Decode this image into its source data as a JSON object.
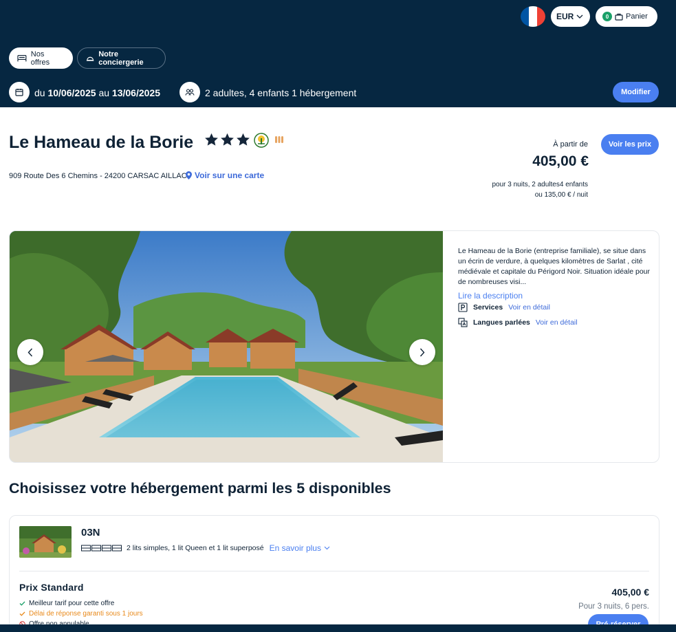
{
  "header": {
    "currency": "EUR",
    "cart_count": "0",
    "cart_label": "Panier",
    "tabs": [
      {
        "label": "Nos offres",
        "icon": "bed-icon"
      },
      {
        "label": "Notre conciergerie",
        "icon": "cloche-icon"
      }
    ],
    "dates": {
      "prefix": "du",
      "start": "10/06/2025",
      "middle": "au",
      "end": "13/06/2025"
    },
    "guests": "2 adultes, 4 enfants 1 hébergement",
    "modify_label": "Modifier",
    "flag_colors": [
      "#0055a4",
      "#ffffff",
      "#ef4135"
    ]
  },
  "hotel": {
    "name": "Le Hameau de la Borie",
    "stars": 3,
    "address": "909 Route Des 6 Chemins - 24200 CARSAC AILLAC",
    "map_link": "Voir sur une carte",
    "from_label": "À partir de",
    "price": "405,00 €",
    "price_line1": "pour 3 nuits, 2 adultes4 enfants",
    "price_line2": "ou 135,00 € / nuit",
    "see_prices_label": "Voir les prix",
    "description": "Le Hameau de la Borie (entreprise familiale), se situe dans un écrin de verdure, à quelques kilomètres de Sarlat , cité médiévale et capitale du Périgord Noir. Situation idéale pour de nombreuses visi...",
    "read_more": "Lire la description",
    "features": [
      {
        "label": "Services",
        "link": "Voir en détail",
        "icon": "parking-icon"
      },
      {
        "label": "Langues parlées",
        "link": "Voir en détail",
        "icon": "translate-icon"
      }
    ]
  },
  "rooms_section": {
    "title": "Choisissez votre hébergement parmi les 5 disponibles"
  },
  "room": {
    "name": "03N",
    "beds": "2 lits simples, 1 lit Queen et 1 lit superposé",
    "know_more": "En savoir plus",
    "rate_name": "Prix Standard",
    "conditions": [
      {
        "text": "Meilleur tarif pour cette offre",
        "color": "#1aa068"
      },
      {
        "text": "Délai de réponse garanti sous 1 jours",
        "color": "#e8891a"
      },
      {
        "text": "Offre non annulable",
        "color": "#d23b3b"
      }
    ],
    "price": "405,00 €",
    "price_detail": "Pour 3 nuits, 6 pers.",
    "book_label": "Pré-réserver"
  },
  "colors": {
    "navy": "#062741",
    "accent": "#4a7ff0",
    "link": "#3d6ad9"
  }
}
